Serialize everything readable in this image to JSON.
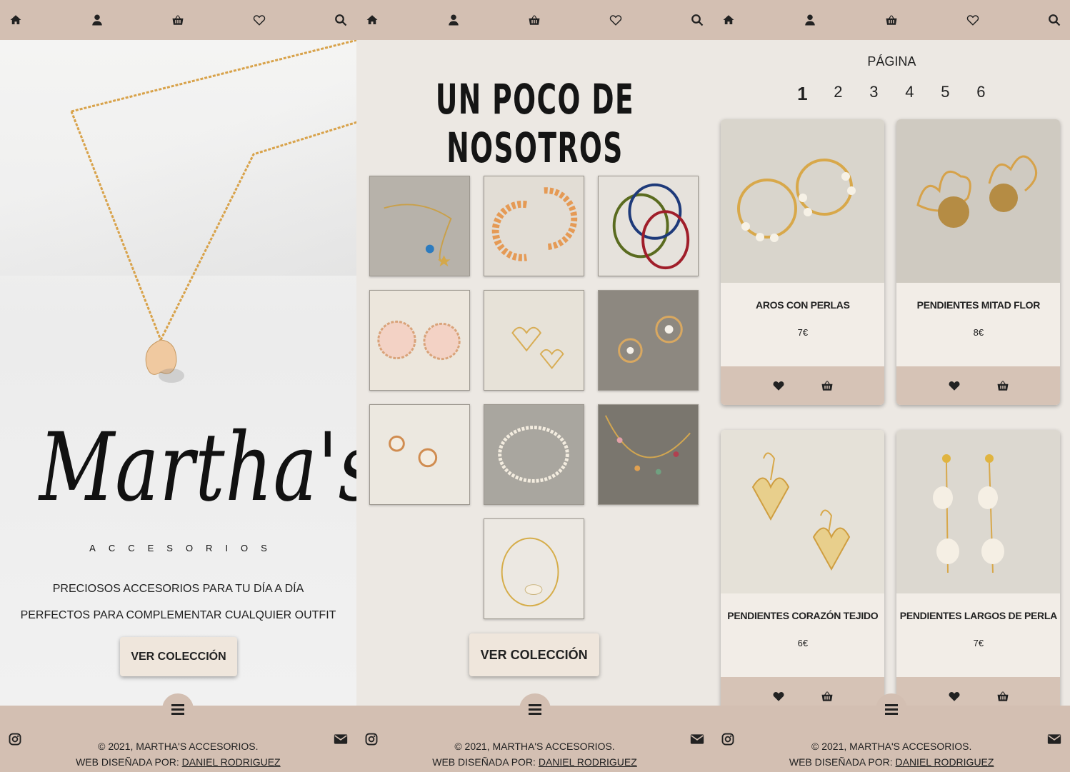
{
  "panels": [
    {
      "nav": [
        "home-icon",
        "user-icon",
        "basket-icon",
        "heart-outline-icon",
        "search-icon"
      ],
      "brand": {
        "name": "Martha's",
        "subtitle": "ACCESORIOS"
      },
      "tagline1": "PRECIOSOS ACCESORIOS PARA TU DÍA A DÍA",
      "tagline2": "PERFECTOS PARA COMPLEMENTAR CUALQUIER OUTFIT",
      "cta": "VER COLECCIÓN"
    },
    {
      "title": "UN POCO DE NOSOTROS",
      "cta": "VER COLECCIÓN"
    },
    {
      "pagination_label": "PÁGINA",
      "pages": [
        "1",
        "2",
        "3",
        "4",
        "5",
        "6"
      ],
      "current_page": "1",
      "products": [
        {
          "name": "AROS CON PERLAS",
          "price": "7€"
        },
        {
          "name": "PENDIENTES MITAD FLOR",
          "price": "8€"
        },
        {
          "name": "PENDIENTES CORAZÓN TEJIDO",
          "price": "6€"
        },
        {
          "name": "PENDIENTES LARGOS DE PERLA",
          "price": "7€"
        }
      ]
    }
  ],
  "footer": {
    "copyright": "© 2021, MARTHA'S ACCESORIOS.",
    "designed_by": "WEB DISEÑADA POR: ",
    "designer": "DANIEL RODRIGUEZ"
  },
  "colors": {
    "bar": "#d3bfb2",
    "button": "#efe6dc",
    "card_actions": "#d6c3b6"
  }
}
